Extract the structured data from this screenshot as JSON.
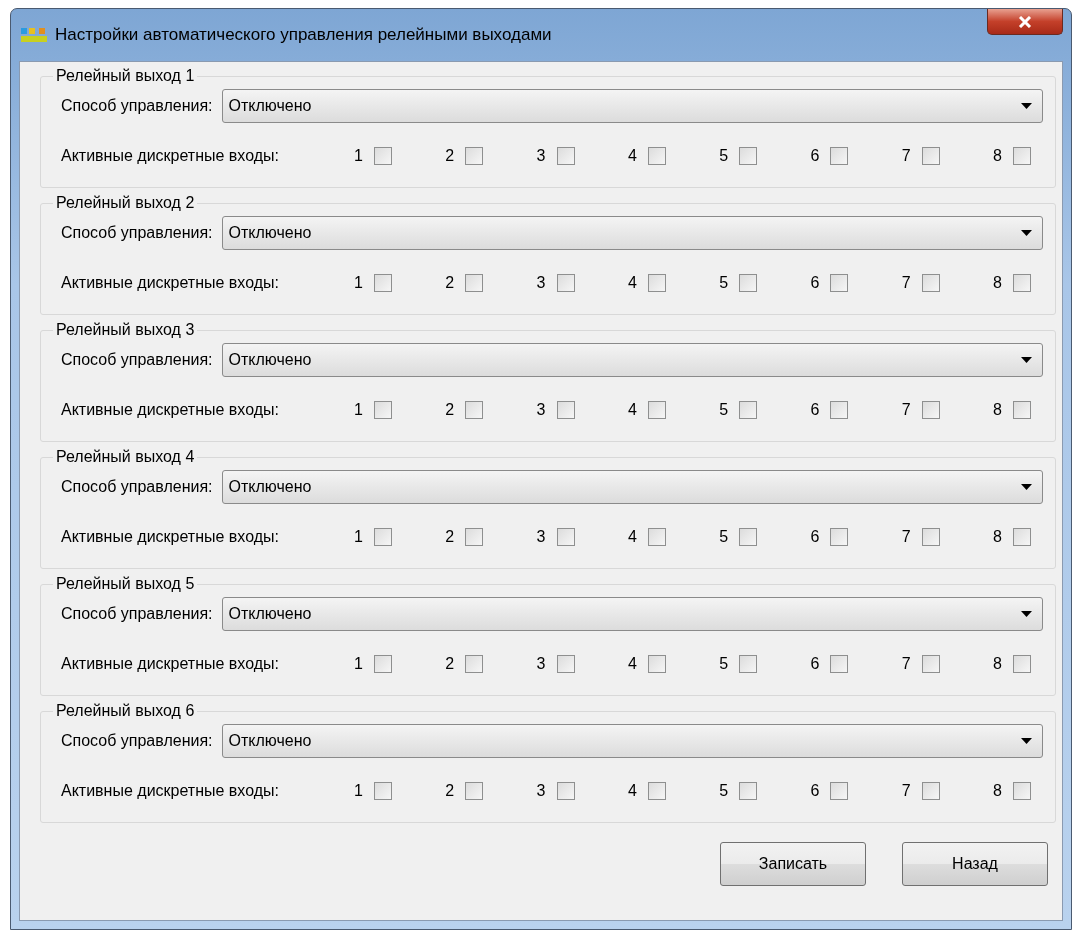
{
  "window": {
    "title": "Настройки автоматического управления релейными выходами"
  },
  "groups": [
    {
      "title": "Релейный выход 1",
      "mode_label": "Способ управления:",
      "mode_value": "Отключено",
      "inputs_label": "Активные дискретные входы:",
      "inputs": [
        {
          "label": "1",
          "checked": false
        },
        {
          "label": "2",
          "checked": false
        },
        {
          "label": "3",
          "checked": false
        },
        {
          "label": "4",
          "checked": false
        },
        {
          "label": "5",
          "checked": false
        },
        {
          "label": "6",
          "checked": false
        },
        {
          "label": "7",
          "checked": false
        },
        {
          "label": "8",
          "checked": false
        }
      ]
    },
    {
      "title": "Релейный выход 2",
      "mode_label": "Способ управления:",
      "mode_value": "Отключено",
      "inputs_label": "Активные дискретные входы:",
      "inputs": [
        {
          "label": "1",
          "checked": false
        },
        {
          "label": "2",
          "checked": false
        },
        {
          "label": "3",
          "checked": false
        },
        {
          "label": "4",
          "checked": false
        },
        {
          "label": "5",
          "checked": false
        },
        {
          "label": "6",
          "checked": false
        },
        {
          "label": "7",
          "checked": false
        },
        {
          "label": "8",
          "checked": false
        }
      ]
    },
    {
      "title": "Релейный выход 3",
      "mode_label": "Способ управления:",
      "mode_value": "Отключено",
      "inputs_label": "Активные дискретные входы:",
      "inputs": [
        {
          "label": "1",
          "checked": false
        },
        {
          "label": "2",
          "checked": false
        },
        {
          "label": "3",
          "checked": false
        },
        {
          "label": "4",
          "checked": false
        },
        {
          "label": "5",
          "checked": false
        },
        {
          "label": "6",
          "checked": false
        },
        {
          "label": "7",
          "checked": false
        },
        {
          "label": "8",
          "checked": false
        }
      ]
    },
    {
      "title": "Релейный выход 4",
      "mode_label": "Способ управления:",
      "mode_value": "Отключено",
      "inputs_label": "Активные дискретные входы:",
      "inputs": [
        {
          "label": "1",
          "checked": false
        },
        {
          "label": "2",
          "checked": false
        },
        {
          "label": "3",
          "checked": false
        },
        {
          "label": "4",
          "checked": false
        },
        {
          "label": "5",
          "checked": false
        },
        {
          "label": "6",
          "checked": false
        },
        {
          "label": "7",
          "checked": false
        },
        {
          "label": "8",
          "checked": false
        }
      ]
    },
    {
      "title": "Релейный выход 5",
      "mode_label": "Способ управления:",
      "mode_value": "Отключено",
      "inputs_label": "Активные дискретные входы:",
      "inputs": [
        {
          "label": "1",
          "checked": false
        },
        {
          "label": "2",
          "checked": false
        },
        {
          "label": "3",
          "checked": false
        },
        {
          "label": "4",
          "checked": false
        },
        {
          "label": "5",
          "checked": false
        },
        {
          "label": "6",
          "checked": false
        },
        {
          "label": "7",
          "checked": false
        },
        {
          "label": "8",
          "checked": false
        }
      ]
    },
    {
      "title": "Релейный выход 6",
      "mode_label": "Способ управления:",
      "mode_value": "Отключено",
      "inputs_label": "Активные дискретные входы:",
      "inputs": [
        {
          "label": "1",
          "checked": false
        },
        {
          "label": "2",
          "checked": false
        },
        {
          "label": "3",
          "checked": false
        },
        {
          "label": "4",
          "checked": false
        },
        {
          "label": "5",
          "checked": false
        },
        {
          "label": "6",
          "checked": false
        },
        {
          "label": "7",
          "checked": false
        },
        {
          "label": "8",
          "checked": false
        }
      ]
    }
  ],
  "buttons": [
    "Записать",
    "Назад"
  ]
}
